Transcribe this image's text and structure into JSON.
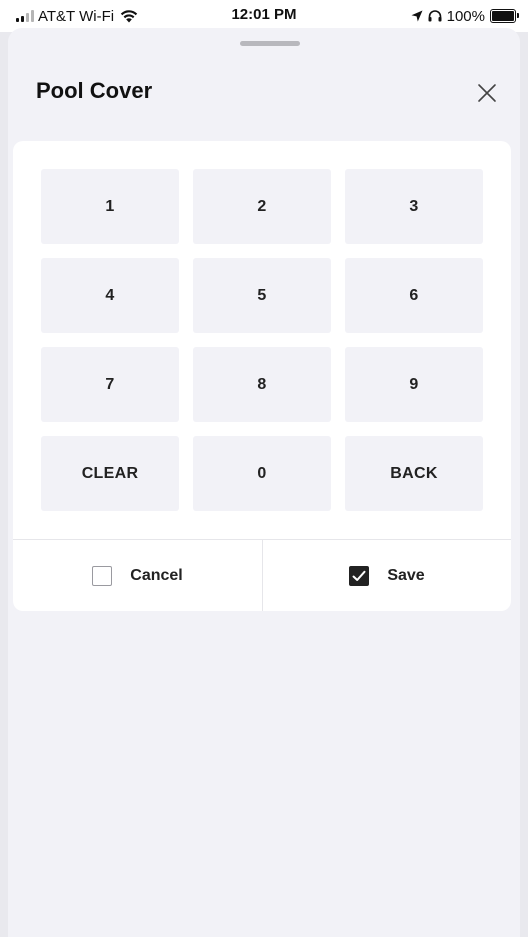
{
  "status_bar": {
    "carrier": "AT&T Wi-Fi",
    "time": "12:01 PM",
    "battery": "100%",
    "battery_level": 1.0
  },
  "sheet": {
    "title": "Pool Cover",
    "close_icon": "close-icon"
  },
  "keypad": {
    "keys": [
      "1",
      "2",
      "3",
      "4",
      "5",
      "6",
      "7",
      "8",
      "9",
      "CLEAR",
      "0",
      "BACK"
    ]
  },
  "actions": {
    "cancel_label": "Cancel",
    "cancel_checked": false,
    "save_label": "Save",
    "save_checked": true
  },
  "colors": {
    "background": "#f2f2f7",
    "card": "#ffffff",
    "key": "#f2f2f7",
    "text": "#222222"
  }
}
